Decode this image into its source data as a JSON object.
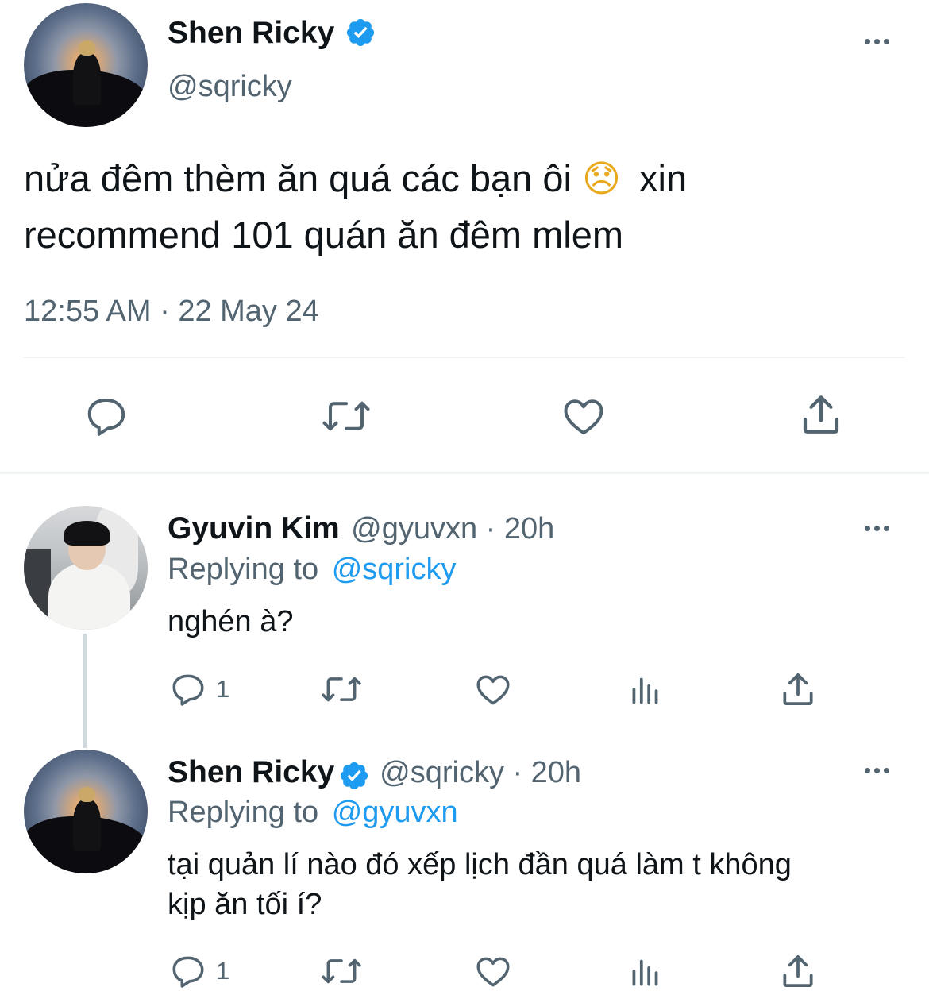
{
  "main_tweet": {
    "author_name": "Shen Ricky",
    "author_handle": "@sqricky",
    "verified": true,
    "text_line1": "nửa đêm thèm ăn quá các bạn ôi",
    "emoji": "😞",
    "text_line1_end": "xin",
    "text_line2": "recommend 101 quán ăn đêm mlem",
    "timestamp": "12:55 AM · 22 May 24",
    "actions": [
      "reply-icon",
      "retweet-icon",
      "like-icon",
      "share-icon"
    ]
  },
  "replies": [
    {
      "author_name": "Gyuvin Kim",
      "author_handle": "@gyuvxn",
      "time": "· 20h",
      "replying_prefix": "Replying to",
      "replying_to": "@sqricky",
      "text": "nghén à?",
      "reply_count": "1",
      "actions": [
        "reply-icon",
        "retweet-icon",
        "like-icon",
        "views-icon",
        "share-icon"
      ]
    },
    {
      "author_name": "Shen Ricky",
      "author_handle": "@sqricky",
      "verified": true,
      "time": "· 20h",
      "replying_prefix": "Replying to",
      "replying_to": "@gyuvxn",
      "text_line1": "tại quản lí nào đó xếp lịch đần quá làm t không",
      "text_line2": "kịp ăn tối í?",
      "reply_count": "1",
      "actions": [
        "reply-icon",
        "retweet-icon",
        "like-icon",
        "views-icon",
        "share-icon"
      ]
    }
  ],
  "colors": {
    "text": "#0f1419",
    "secondary": "#536471",
    "accent": "#1d9bf0",
    "divider": "#eff3f4"
  }
}
